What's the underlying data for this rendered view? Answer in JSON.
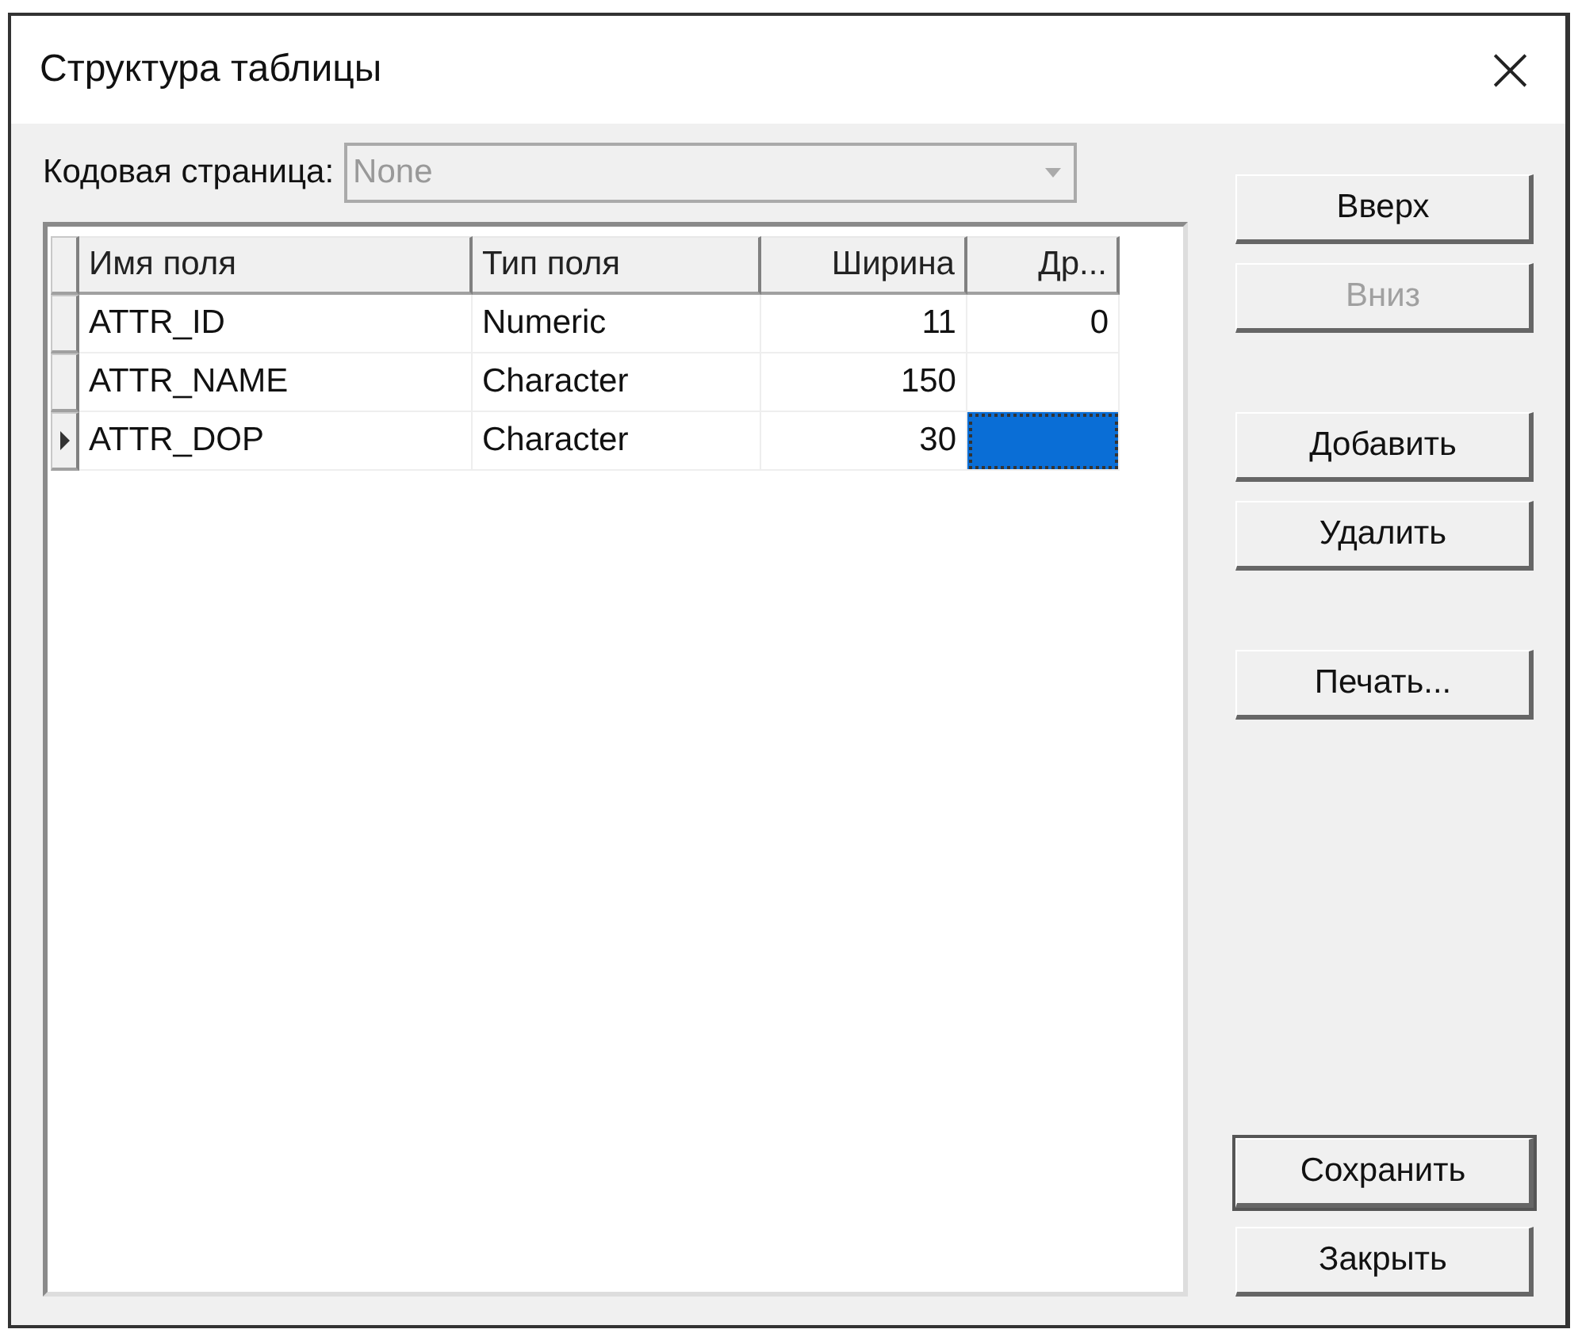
{
  "window": {
    "title": "Структура таблицы",
    "close": "×"
  },
  "codepage": {
    "label": "Кодовая страница:",
    "value": "None",
    "disabled": true
  },
  "table": {
    "columns": [
      {
        "label": "Имя поля",
        "numeric": false
      },
      {
        "label": "Тип поля",
        "numeric": false
      },
      {
        "label": "Ширина",
        "numeric": true
      },
      {
        "label": "Др...",
        "numeric": true
      }
    ],
    "rows": [
      {
        "selected": false,
        "cells": [
          {
            "text": "ATTR_ID",
            "selected": false
          },
          {
            "text": "Numeric",
            "selected": false
          },
          {
            "text": "11",
            "selected": false
          },
          {
            "text": "0",
            "selected": false
          }
        ]
      },
      {
        "selected": false,
        "cells": [
          {
            "text": "ATTR_NAME",
            "selected": false
          },
          {
            "text": "Character",
            "selected": false
          },
          {
            "text": "150",
            "selected": false
          },
          {
            "selected": false
          }
        ]
      },
      {
        "selected": true,
        "cells": [
          {
            "text": "ATTR_DOP",
            "selected": false
          },
          {
            "text": "Character",
            "selected": false
          },
          {
            "text": "30",
            "selected": false
          },
          {
            "selected": true
          }
        ]
      }
    ]
  },
  "button_groups": [
    [
      {
        "label": "Вверх",
        "disabled": false,
        "default": false
      },
      {
        "label": "Вниз",
        "disabled": true,
        "default": false
      }
    ],
    [
      {
        "label": "Добавить",
        "disabled": false,
        "default": false
      },
      {
        "label": "Удалить",
        "disabled": false,
        "default": false
      }
    ],
    [
      {
        "label": "Печать...",
        "disabled": false,
        "default": false
      }
    ],
    [
      {
        "label": "Сохранить",
        "disabled": false,
        "default": true
      },
      {
        "label": "Закрыть",
        "disabled": false,
        "default": false
      }
    ]
  ]
}
